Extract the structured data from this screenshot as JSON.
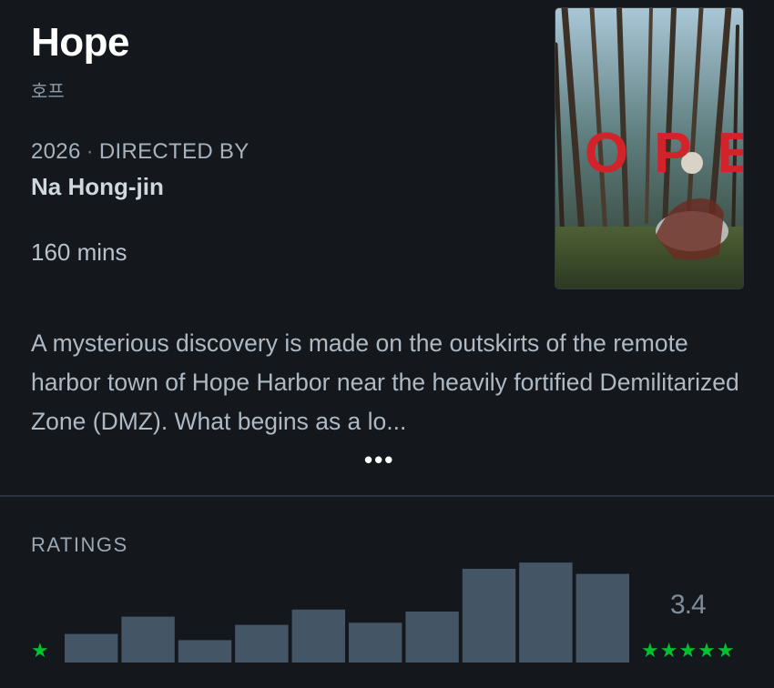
{
  "film": {
    "title": "Hope",
    "original_title": "호프",
    "year": "2026",
    "meta_separator": "·",
    "directed_by_label": "DIRECTED BY",
    "director": "Na Hong-jin",
    "runtime": "160 mins",
    "synopsis": "A mysterious discovery is made on the outskirts of the remote harbor town of Hope Harbor near the heavily fortified Demilitarized Zone (DMZ). What begins as a lo...",
    "more_label": "•••"
  },
  "poster": {
    "title_text": "HOPE",
    "title_color": "#d2232a"
  },
  "ratings": {
    "label": "RATINGS",
    "average": "3.4",
    "low_star": "★",
    "high_stars": "★★★★★",
    "star_color": "#00c030",
    "bar_color": "#445566"
  },
  "chart_data": {
    "type": "bar",
    "categories": [
      "0.5",
      "1",
      "1.5",
      "2",
      "2.5",
      "3",
      "3.5",
      "4",
      "4.5",
      "5"
    ],
    "values": [
      28,
      45,
      22,
      37,
      52,
      39,
      50,
      92,
      98,
      87
    ]
  }
}
